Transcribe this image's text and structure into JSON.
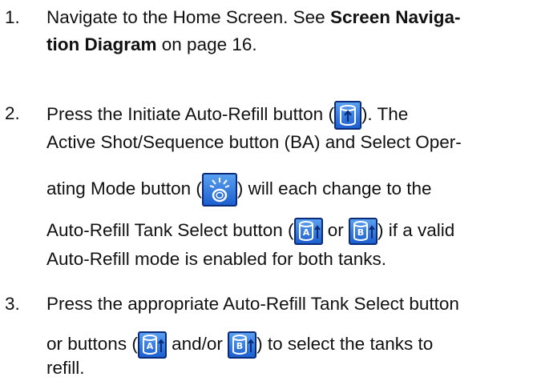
{
  "steps": [
    {
      "number": "1.",
      "line1_a": "Navigate to the Home Screen. See ",
      "line1_bold": "Screen Naviga-",
      "line2_bold": "tion Diagram",
      "line2_b": " on page 16."
    },
    {
      "number": "2.",
      "line1_a": "Press the Initiate Auto-Refill button (",
      "line1_b": "). The",
      "line2": "Active Shot/Sequence button (BA) and Select Oper-",
      "line3_a": "ating Mode button (",
      "line3_b": ") will each change to the",
      "line4_a": "Auto-Refill Tank Select button (",
      "line4_or": " or ",
      "line4_b": ") if a valid",
      "line5": "Auto-Refill mode is enabled for both tanks."
    },
    {
      "number": "3.",
      "line1": "Press the appropriate Auto-Refill Tank Select button",
      "line2_a": "or buttons (",
      "line2_andor": " and/or ",
      "line2_b": ") to select the tanks to",
      "line3": "refill."
    }
  ],
  "icons": {
    "initiate_auto_refill": "initiate-auto-refill-icon",
    "select_operating_mode": "select-operating-mode-icon",
    "tank_a_select": "tank-a-select-icon",
    "tank_b_select": "tank-b-select-icon"
  },
  "colors": {
    "icon_blue": "#1c5fcf",
    "icon_border": "#0a2a7a",
    "text": "#111111"
  }
}
